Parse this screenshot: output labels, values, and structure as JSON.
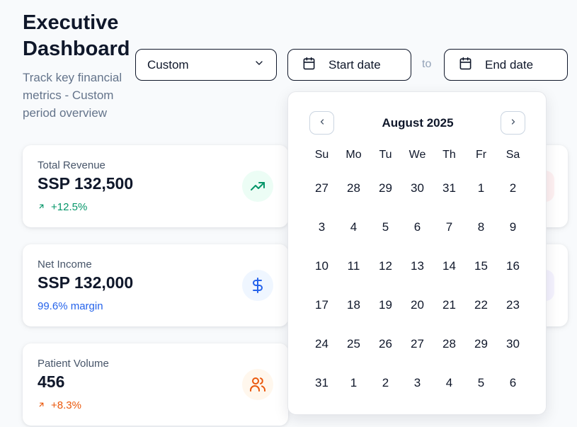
{
  "header": {
    "title": "Executive Dashboard",
    "subtitle": "Track key financial metrics - Custom period overview"
  },
  "filters": {
    "period_select": {
      "value": "Custom",
      "icon": "chevron-down-icon"
    },
    "start_date": {
      "label": "Start date",
      "icon": "calendar-icon"
    },
    "separator": "to",
    "end_date": {
      "label": "End date",
      "icon": "calendar-icon"
    }
  },
  "cards": [
    {
      "label": "Total Revenue",
      "value": "SSP 132,500",
      "sub": "+12.5%",
      "sub_color": "#059669",
      "icon": "trending-up-icon",
      "icon_bg": "#ecfdf5",
      "icon_color": "#059669"
    },
    {
      "label": "Net Income",
      "value": "SSP 132,000",
      "sub": "99.6% margin",
      "sub_color": "#2563eb",
      "icon": "dollar-icon",
      "icon_bg": "#eff6ff",
      "icon_color": "#2563eb"
    },
    {
      "label": "Patient Volume",
      "value": "456",
      "sub": "+8.3%",
      "sub_color": "#ea580c",
      "icon": "users-icon",
      "icon_bg": "#fff7ed",
      "icon_color": "#ea580c"
    }
  ],
  "calendar": {
    "month_label": "August 2025",
    "weekdays": [
      "Su",
      "Mo",
      "Tu",
      "We",
      "Th",
      "Fr",
      "Sa"
    ],
    "days": [
      "27",
      "28",
      "29",
      "30",
      "31",
      "1",
      "2",
      "3",
      "4",
      "5",
      "6",
      "7",
      "8",
      "9",
      "10",
      "11",
      "12",
      "13",
      "14",
      "15",
      "16",
      "17",
      "18",
      "19",
      "20",
      "21",
      "22",
      "23",
      "24",
      "25",
      "26",
      "27",
      "28",
      "29",
      "30",
      "31",
      "1",
      "2",
      "3",
      "4",
      "5",
      "6"
    ]
  },
  "colors": {
    "text_primary": "#0f172a",
    "text_muted": "#64748b",
    "border": "#0f172a"
  }
}
